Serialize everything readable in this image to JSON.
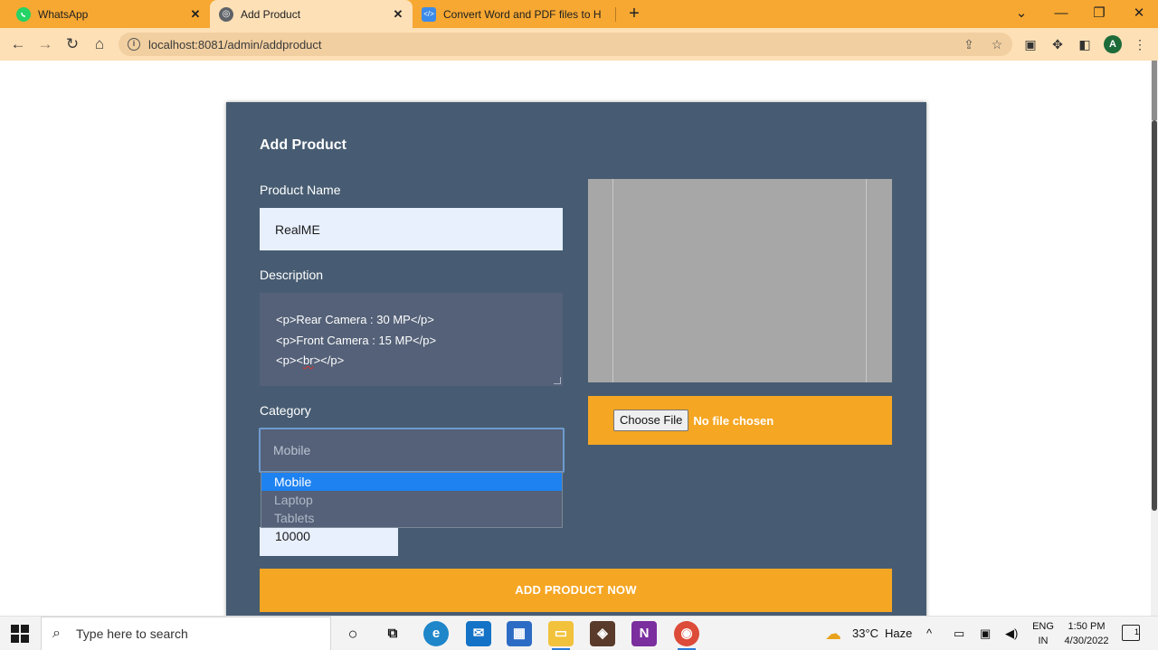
{
  "browser": {
    "tabs": [
      {
        "title": "WhatsApp",
        "icon": "whatsapp-icon",
        "color": "#25d366",
        "active": false
      },
      {
        "title": "Add Product",
        "icon": "globe-icon",
        "color": "#5f6368",
        "active": true
      },
      {
        "title": "Convert Word and PDF files to H",
        "icon": "code-icon",
        "color": "#3d8be8",
        "active": false
      }
    ],
    "url": "localhost:8081/admin/addproduct",
    "profile_initial": "A"
  },
  "form": {
    "heading": "Add Product",
    "product_name_label": "Product Name",
    "product_name_value": "RealME",
    "description_label": "Description",
    "description_lines": {
      "line1": "<p>Rear Camera : 30 MP</p>",
      "line2": "<p>Front Camera : 15 MP</p>",
      "line3_pre": "<p><",
      "line3_word": "br",
      "line3_post": "></p>"
    },
    "category_label": "Category",
    "category_selected": "Mobile",
    "category_options": [
      "Mobile",
      "Laptop",
      "Tablets"
    ],
    "price_value": "10000",
    "choose_file_label": "Choose File",
    "no_file_text": "No file chosen",
    "submit_label": "ADD PRODUCT NOW"
  },
  "taskbar": {
    "search_placeholder": "Type here to search",
    "weather": "33°C",
    "weather_desc": "Haze",
    "lang_top": "ENG",
    "lang_bottom": "IN",
    "time": "1:50 PM",
    "date": "4/30/2022",
    "notification_count": "1"
  },
  "colors": {
    "title_bar": "#f7a832",
    "card": "#475c72",
    "accent": "#f5a623",
    "selected_option": "#1e82f0"
  }
}
